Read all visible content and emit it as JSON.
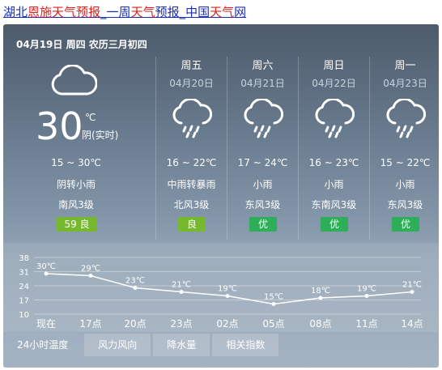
{
  "header": {
    "segments": [
      {
        "text": "湖北",
        "red": false
      },
      {
        "text": "恩施",
        "red": true
      },
      {
        "text": "天气预报",
        "red": true
      },
      {
        "text": "_一周",
        "red": false
      },
      {
        "text": "天气",
        "red": true
      },
      {
        "text": "预报",
        "red": false
      },
      {
        "text": "_中国",
        "red": false
      },
      {
        "text": "天气",
        "red": true
      },
      {
        "text": "网",
        "red": false
      }
    ]
  },
  "today": {
    "date_line": "04月19日 周四 农历三月初四",
    "icon": "cloudy-icon",
    "temp": "30",
    "unit": "℃",
    "condition_now": "阴(实时)",
    "range": "15 ~ 30℃",
    "desc": "阴转小雨",
    "wind": "南风3级",
    "aqi_value": "59",
    "aqi_label": "良"
  },
  "forecast": [
    {
      "name": "周五",
      "date": "04月20日",
      "icon": "rain-icon",
      "range": "16 ~ 22℃",
      "desc": "中雨转暴雨",
      "wind": "北风3级",
      "aqi": "良"
    },
    {
      "name": "周六",
      "date": "04月21日",
      "icon": "rain-icon",
      "range": "17 ~ 24℃",
      "desc": "小雨",
      "wind": "东风3级",
      "aqi": "优"
    },
    {
      "name": "周日",
      "date": "04月22日",
      "icon": "rain-icon",
      "range": "16 ~ 23℃",
      "desc": "小雨",
      "wind": "东南风3级",
      "aqi": "优"
    },
    {
      "name": "周一",
      "date": "04月23日",
      "icon": "rain-icon",
      "range": "15 ~ 22℃",
      "desc": "小雨",
      "wind": "东风3级",
      "aqi": "优"
    }
  ],
  "colors": {
    "aqi_good": "#77b92e",
    "aqi_excellent": "#2fae5a"
  },
  "tabs": [
    "24小时温度",
    "风力风向",
    "降水量",
    "相关指数"
  ],
  "chart_data": {
    "type": "line",
    "categories": [
      "现在",
      "17点",
      "20点",
      "23点",
      "02点",
      "05点",
      "08点",
      "11点",
      "14点"
    ],
    "values": [
      30,
      29,
      23,
      21,
      19,
      15,
      18,
      19,
      21
    ],
    "labels": [
      "30℃",
      "29℃",
      "23℃",
      "21℃",
      "19℃",
      "15℃",
      "18℃",
      "19℃",
      "21℃"
    ],
    "ytick_labels": [
      "38",
      "31",
      "24",
      "17",
      "10"
    ],
    "ylim": [
      10,
      38
    ],
    "grid": true
  }
}
